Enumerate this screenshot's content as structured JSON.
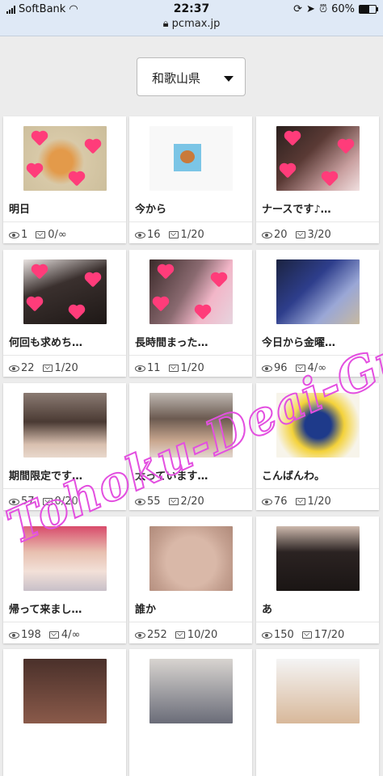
{
  "status_bar": {
    "carrier": "SoftBank",
    "time": "22:37",
    "url": "pcmax.jp",
    "battery": "60%",
    "battery_level": 0.6
  },
  "filter": {
    "prefecture": "和歌山県"
  },
  "cards": [
    {
      "name": "明日",
      "views": "1",
      "mail": "0/∞",
      "thumb": "kitten"
    },
    {
      "name": "今から",
      "views": "16",
      "mail": "1/20",
      "thumb": "bear"
    },
    {
      "name": "ナースです♪…",
      "views": "20",
      "mail": "3/20",
      "thumb": "nurse"
    },
    {
      "name": "何回も求めち…",
      "views": "22",
      "mail": "1/20",
      "thumb": "dark1"
    },
    {
      "name": "長時間まった…",
      "views": "11",
      "mail": "1/20",
      "thumb": "pink"
    },
    {
      "name": "今日から金曜…",
      "views": "96",
      "mail": "4/∞",
      "thumb": "blue"
    },
    {
      "name": "期間限定です…",
      "views": "57",
      "mail": "0/20",
      "thumb": "girl1"
    },
    {
      "name": "太っています…",
      "views": "55",
      "mail": "2/20",
      "thumb": "girl2"
    },
    {
      "name": "こんばんわ。",
      "views": "76",
      "mail": "1/20",
      "thumb": "art"
    },
    {
      "name": "帰って来まし…",
      "views": "198",
      "mail": "4/∞",
      "thumb": "woman"
    },
    {
      "name": "誰か",
      "views": "252",
      "mail": "10/20",
      "thumb": "skin"
    },
    {
      "name": "あ",
      "views": "150",
      "mail": "17/20",
      "thumb": "lace"
    }
  ],
  "watermark": "Tohoku-Deai-Guide.net"
}
